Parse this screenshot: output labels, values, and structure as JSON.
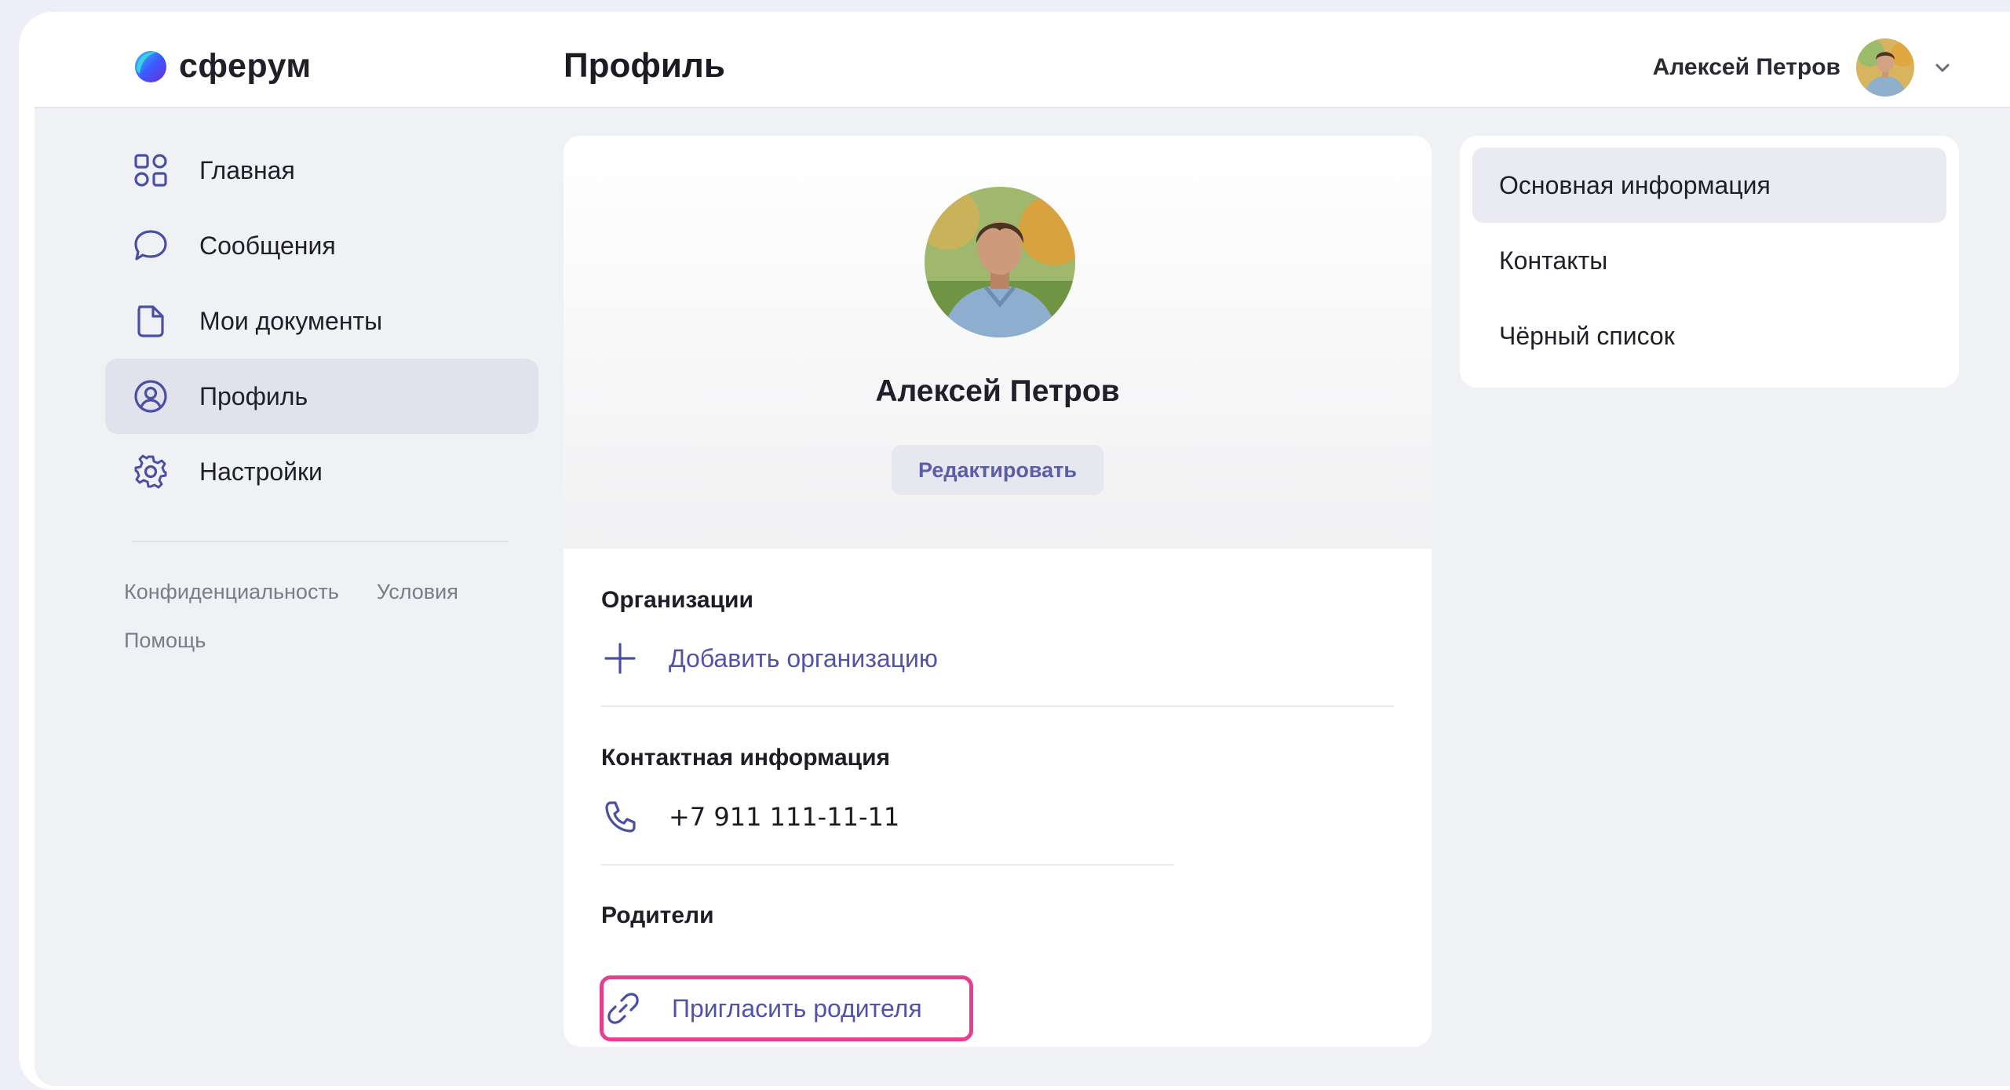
{
  "logo": {
    "text": "сферум"
  },
  "header": {
    "title": "Профиль",
    "user_name": "Алексей Петров"
  },
  "sidebar": {
    "items": [
      {
        "label": "Главная",
        "icon": "grid-icon",
        "active": false
      },
      {
        "label": "Сообщения",
        "icon": "chat-bubble-icon",
        "active": false
      },
      {
        "label": "Мои документы",
        "icon": "document-icon",
        "active": false
      },
      {
        "label": "Профиль",
        "icon": "user-circle-icon",
        "active": true
      },
      {
        "label": "Настройки",
        "icon": "gear-icon",
        "active": false
      }
    ],
    "footer": {
      "privacy": "Конфиденциальность",
      "terms": "Условия",
      "help": "Помощь"
    }
  },
  "profile": {
    "name": "Алексей Петров",
    "edit_label": "Редактировать",
    "organizations": {
      "title": "Организации",
      "add_label": "Добавить организацию"
    },
    "contacts": {
      "title": "Контактная информация",
      "phone": "+7 911 111-11-11"
    },
    "parents": {
      "title": "Родители",
      "invite_label": "Пригласить родителя"
    }
  },
  "right_menu": {
    "items": [
      {
        "label": "Основная информация",
        "active": true
      },
      {
        "label": "Контакты",
        "active": false
      },
      {
        "label": "Чёрный список",
        "active": false
      }
    ]
  },
  "colors": {
    "accent_link": "#5253a8",
    "active_bg": "#e1e2ec",
    "highlight": "#e5408f",
    "page_bg": "#f0f1f4"
  }
}
